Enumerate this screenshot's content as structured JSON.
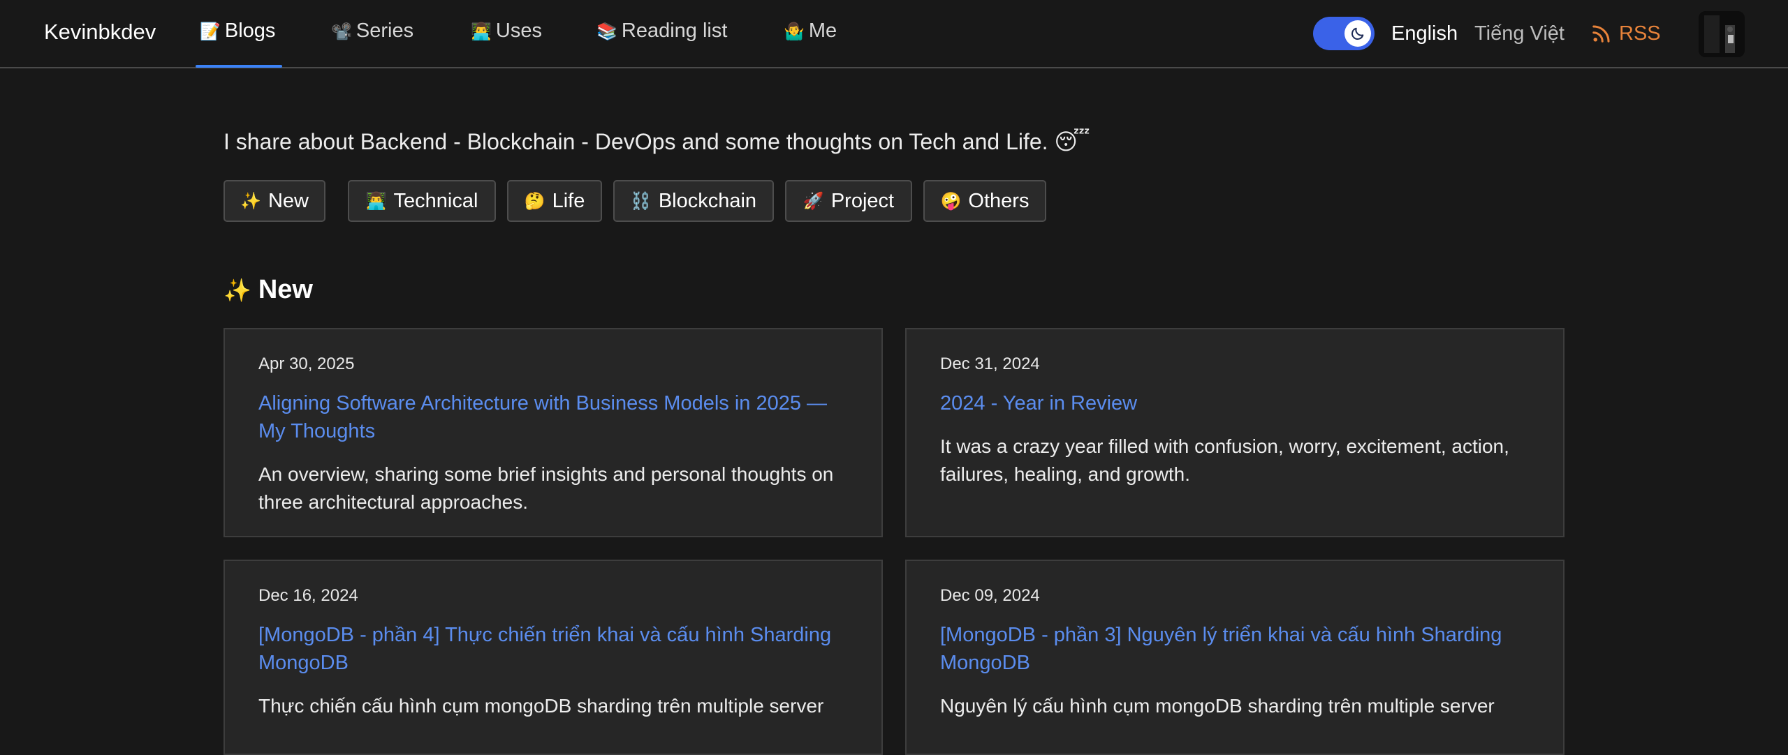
{
  "brand": "Kevinbkdev",
  "nav": [
    {
      "emoji": "📝",
      "label": "Blogs"
    },
    {
      "emoji": "📽️",
      "label": "Series"
    },
    {
      "emoji": "👨‍💻",
      "label": "Uses"
    },
    {
      "emoji": "📚",
      "label": "Reading list"
    },
    {
      "emoji": "🤷‍♂️",
      "label": "Me"
    }
  ],
  "theme_toggle": {
    "state": "dark",
    "icon": "moon-icon",
    "color": "#3a62e8"
  },
  "languages": {
    "english": "English",
    "vietnamese": "Tiếng Việt"
  },
  "rss": {
    "label": "RSS",
    "icon": "rss-icon",
    "color": "#e8833a"
  },
  "tagline": "I share about Backend - Blockchain - DevOps and some thoughts on Tech and Life. 😴",
  "categories": [
    {
      "emoji": "✨",
      "label": "New"
    },
    {
      "emoji": "👨‍💻",
      "label": "Technical"
    },
    {
      "emoji": "🤔",
      "label": "Life"
    },
    {
      "emoji": "⛓️",
      "label": "Blockchain"
    },
    {
      "emoji": "🚀",
      "label": "Project"
    },
    {
      "emoji": "🤪",
      "label": "Others"
    }
  ],
  "section": {
    "emoji": "✨",
    "title": "New"
  },
  "posts": [
    {
      "date": "Apr 30, 2025",
      "title": "Aligning Software Architecture with Business Models in 2025 — My Thoughts",
      "description": "An overview, sharing some brief insights and personal thoughts on three architectural approaches."
    },
    {
      "date": "Dec 31, 2024",
      "title": "2024 - Year in Review",
      "description": "It was a crazy year filled with confusion, worry, excitement, action, failures, healing, and growth."
    },
    {
      "date": "Dec 16, 2024",
      "title": "[MongoDB - phần 4] Thực chiến triển khai và cấu hình Sharding MongoDB",
      "description": "Thực chiến cấu hình cụm mongoDB sharding trên multiple server"
    },
    {
      "date": "Dec 09, 2024",
      "title": "[MongoDB - phần 3] Nguyên lý triển khai và cấu hình Sharding MongoDB",
      "description": "Nguyên lý cấu hình cụm mongoDB sharding trên multiple server"
    }
  ],
  "colors": {
    "link": "#5b8def",
    "accent": "#3b82f6",
    "background": "#181818",
    "card": "#262626"
  }
}
